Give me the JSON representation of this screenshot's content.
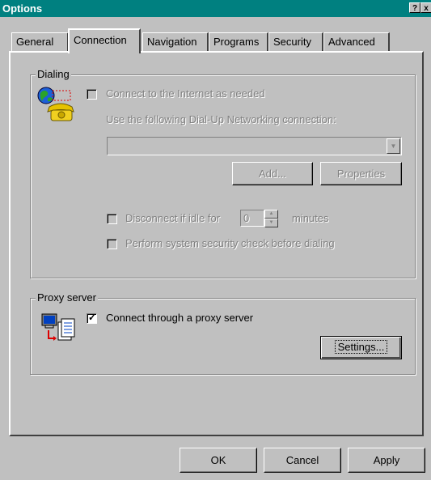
{
  "window": {
    "title": "Options",
    "help_glyph": "?",
    "close_glyph": "x"
  },
  "tabs": [
    {
      "label": "General"
    },
    {
      "label": "Connection"
    },
    {
      "label": "Navigation"
    },
    {
      "label": "Programs"
    },
    {
      "label": "Security"
    },
    {
      "label": "Advanced"
    }
  ],
  "dialing": {
    "group_label": "Dialing",
    "connect_as_needed": {
      "label": "Connect to the Internet as needed",
      "checked": false
    },
    "dialup_label": "Use the following Dial-Up Networking connection:",
    "dialup_value": "",
    "add_label": "Add...",
    "properties_label": "Properties",
    "disconnect": {
      "label_before": "Disconnect if idle for",
      "value": "0",
      "label_after": "minutes",
      "checked": false
    },
    "security_check": {
      "label": "Perform system security check before dialing",
      "checked": false
    }
  },
  "proxy": {
    "group_label": "Proxy server",
    "connect_through_proxy": {
      "label": "Connect through a proxy server",
      "checked": true
    },
    "settings_label": "Settings..."
  },
  "footer": {
    "ok_label": "OK",
    "cancel_label": "Cancel",
    "apply_label": "Apply"
  }
}
